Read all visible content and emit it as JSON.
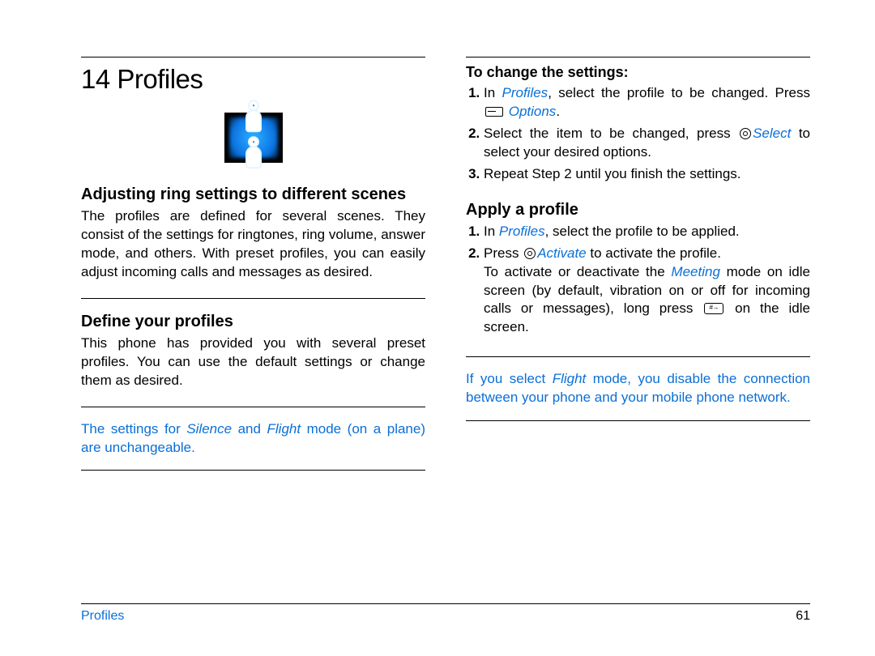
{
  "chapter_title": "14 Profiles",
  "left": {
    "h2a": "Adjusting ring settings to different scenes",
    "p1": "The profiles are defined for several scenes. They consist of the settings for ringtones, ring volume, answer mode, and others. With preset profiles, you can easily adjust incoming calls and messages as desired.",
    "h2b": "Define your profiles",
    "p2": "This phone has provided you with several preset profiles. You can use the default settings or change them as desired.",
    "note1_a": "The settings for ",
    "note1_silence": "Silence",
    "note1_b": " and ",
    "note1_flight": "Flight",
    "note1_c": " mode (on a plane) are unchangeable."
  },
  "right": {
    "h3a": "To change the settings:",
    "step1_a": "In ",
    "step1_profiles": "Profiles",
    "step1_b": ", select the profile to be changed. Press ",
    "step1_options": " Options",
    "step1_c": ".",
    "step2_a": "Select the item to be changed, press ",
    "step2_select": "Select",
    "step2_b": " to select your desired options.",
    "step3": "Repeat Step 2 until you finish the settings.",
    "h2c": "Apply a profile",
    "apply1_a": "In ",
    "apply1_profiles": "Profiles",
    "apply1_b": ", select the profile to be applied.",
    "apply2_a": "Press ",
    "apply2_activate": "Activate",
    "apply2_b": " to activate the profile.",
    "apply2_c": "To activate or deactivate the ",
    "apply2_meeting": "Meeting",
    "apply2_d": " mode on idle screen (by default, vibration on or off for incoming calls or messages), long press ",
    "apply2_e": " on the idle screen.",
    "note2_a": "If you select ",
    "note2_flight": "Flight",
    "note2_b": " mode, you disable the connection between your phone and your mobile phone network."
  },
  "footer": {
    "section": "Profiles",
    "page": "61"
  }
}
